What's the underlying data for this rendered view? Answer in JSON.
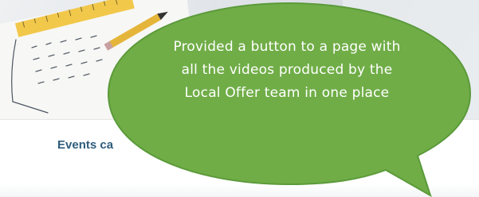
{
  "card": {
    "title": "Events ca"
  },
  "callout": {
    "text": "Provided a button to a page with all the videos produced by the Local Offer team in one place",
    "fill_color": "#70ad47",
    "border_color": "#5b9a3a"
  },
  "hero": {
    "accent": "#f2c84b"
  }
}
